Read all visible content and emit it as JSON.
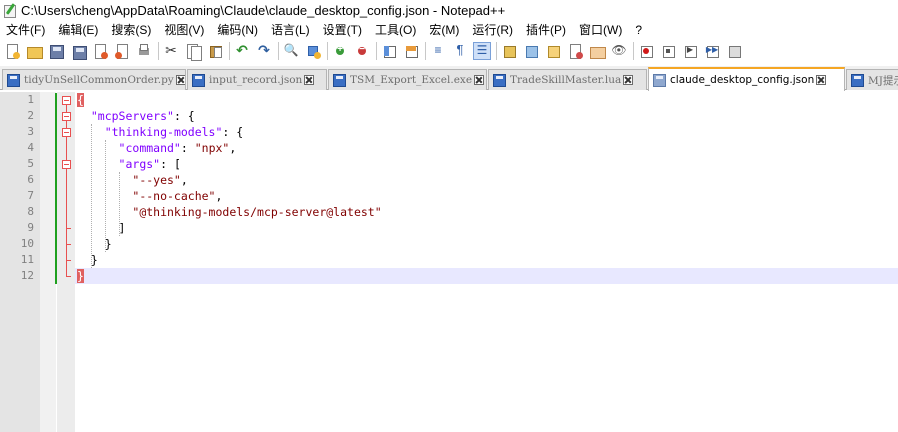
{
  "window": {
    "title": "C:\\Users\\cheng\\AppData\\Roaming\\Claude\\claude_desktop_config.json - Notepad++"
  },
  "menu": {
    "items": [
      "文件(F)",
      "编辑(E)",
      "搜索(S)",
      "视图(V)",
      "编码(N)",
      "语言(L)",
      "设置(T)",
      "工具(O)",
      "宏(M)",
      "运行(R)",
      "插件(P)",
      "窗口(W)",
      "?"
    ]
  },
  "toolbar": {
    "buttons": [
      {
        "icon": "new-file-icon"
      },
      {
        "icon": "open-file-icon"
      },
      {
        "icon": "save-icon"
      },
      {
        "icon": "save-all-icon"
      },
      {
        "icon": "close-icon"
      },
      {
        "icon": "close-all-icon"
      },
      {
        "icon": "print-icon"
      },
      {
        "icon": "cut-icon"
      },
      {
        "icon": "copy-icon"
      },
      {
        "icon": "paste-icon"
      },
      {
        "icon": "undo-icon"
      },
      {
        "icon": "redo-icon"
      },
      {
        "icon": "find-icon"
      },
      {
        "icon": "replace-icon"
      },
      {
        "icon": "zoom-in-icon"
      },
      {
        "icon": "zoom-out-icon"
      },
      {
        "icon": "sync-vertical-icon"
      },
      {
        "icon": "sync-horizontal-icon"
      },
      {
        "icon": "word-wrap-icon"
      },
      {
        "icon": "show-all-chars-icon"
      },
      {
        "icon": "indent-guide-icon"
      },
      {
        "icon": "udl-icon"
      },
      {
        "icon": "doc-map-icon"
      },
      {
        "icon": "doc-list-icon"
      },
      {
        "icon": "function-list-icon"
      },
      {
        "icon": "folder-workspace-icon"
      },
      {
        "icon": "monitoring-icon"
      },
      {
        "icon": "record-macro-icon"
      },
      {
        "icon": "stop-macro-icon"
      },
      {
        "icon": "play-macro-icon"
      },
      {
        "icon": "run-macro-multiple-icon"
      },
      {
        "icon": "save-macro-icon"
      }
    ]
  },
  "tabs": [
    {
      "label": "tidyUnSellCommonOrder.py",
      "active": false
    },
    {
      "label": "input_record.json",
      "active": false
    },
    {
      "label": "TSM_Export_Excel.exe",
      "active": false
    },
    {
      "label": "TradeSkillMaster.lua",
      "active": false
    },
    {
      "label": "claude_desktop_config.json",
      "active": true
    },
    {
      "label": "MJ提示",
      "active": false
    }
  ],
  "editor": {
    "line_numbers": [
      "1",
      "2",
      "3",
      "4",
      "5",
      "6",
      "7",
      "8",
      "9",
      "10",
      "11",
      "12"
    ],
    "lines": [
      [
        {
          "t": "{",
          "c": "brace-hl"
        }
      ],
      [
        {
          "t": "  "
        },
        {
          "t": "\"mcpServers\"",
          "c": "key"
        },
        {
          "t": ": {"
        }
      ],
      [
        {
          "t": "    "
        },
        {
          "t": "\"thinking-models\"",
          "c": "key"
        },
        {
          "t": ": {"
        }
      ],
      [
        {
          "t": "      "
        },
        {
          "t": "\"command\"",
          "c": "key"
        },
        {
          "t": ": "
        },
        {
          "t": "\"npx\"",
          "c": "str"
        },
        {
          "t": ","
        }
      ],
      [
        {
          "t": "      "
        },
        {
          "t": "\"args\"",
          "c": "key"
        },
        {
          "t": ": ["
        }
      ],
      [
        {
          "t": "        "
        },
        {
          "t": "\"--yes\"",
          "c": "str"
        },
        {
          "t": ","
        }
      ],
      [
        {
          "t": "        "
        },
        {
          "t": "\"--no-cache\"",
          "c": "str"
        },
        {
          "t": ","
        }
      ],
      [
        {
          "t": "        "
        },
        {
          "t": "\"@thinking-models/mcp-server@latest\"",
          "c": "str"
        }
      ],
      [
        {
          "t": "      ]"
        }
      ],
      [
        {
          "t": "    }"
        }
      ],
      [
        {
          "t": "  }"
        }
      ],
      [
        {
          "t": "}",
          "c": "brace-hl"
        }
      ]
    ],
    "current_line": 12
  }
}
